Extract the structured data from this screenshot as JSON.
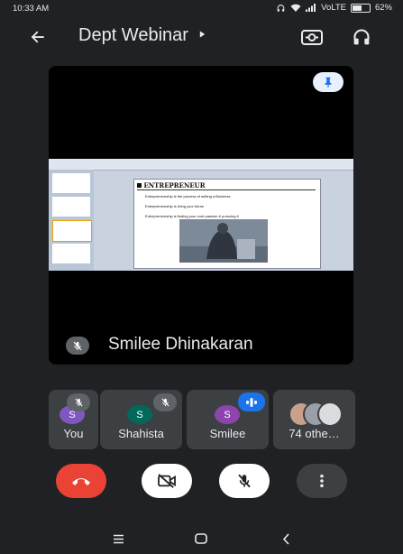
{
  "status_bar": {
    "time": "10:33 AM",
    "network": "VoLTE",
    "battery": "62%",
    "battery_level": 0.62
  },
  "app_bar": {
    "title": "Dept Webinar"
  },
  "main_tile": {
    "speaker_name": "Smilee Dhinakaran",
    "slide": {
      "heading": "ENTREPRENEUR",
      "bullets": [
        "Entrepreneurship is the process of setting a Business",
        "Entrepreneurship is living your future",
        "Entrepreneurship is finding your core passion & pursuing it"
      ]
    }
  },
  "participants": [
    {
      "name": "You",
      "initial": "S",
      "color": "#7e57c2",
      "muted": true
    },
    {
      "name": "Shahista",
      "initial": "S",
      "color": "#00695c",
      "muted": true
    },
    {
      "name": "Smilee",
      "initial": "S",
      "color": "#8e44ad",
      "speaking": true
    },
    {
      "name": "74 othe…"
    }
  ],
  "colors": {
    "end_call": "#ea4335",
    "control_light": "#ffffff",
    "control_dark": "#3c4043",
    "speaking_badge": "#1a73e8"
  },
  "icons": [
    "back-arrow-icon",
    "dropdown-arrow-icon",
    "switch-camera-icon",
    "headphones-icon",
    "pin-icon",
    "mic-off-icon",
    "end-call-icon",
    "camera-off-icon",
    "more-vert-icon"
  ]
}
